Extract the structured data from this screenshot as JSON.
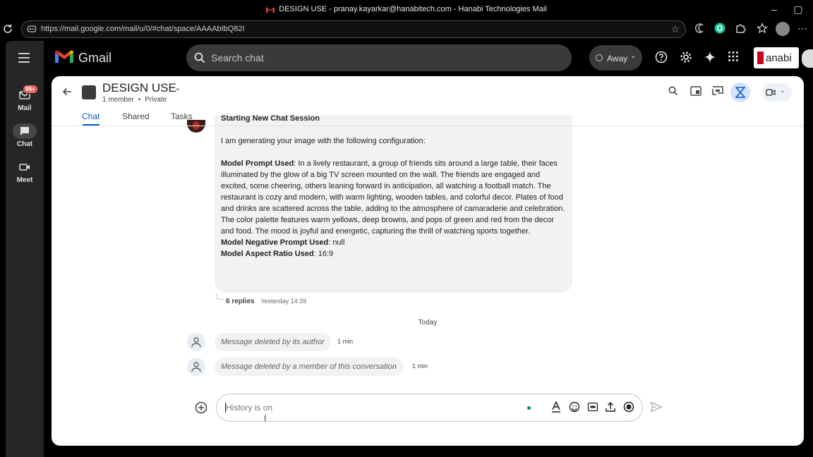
{
  "window": {
    "title": "DESIGN USE - pranay.kayarkar@hanabitech.com - Hanabi Technologies Mail",
    "minimize_label": "–",
    "maximize_label": "▢"
  },
  "browser": {
    "url": "https://mail.google.com/mail/u/0/#chat/space/AAAAbIbQ82I"
  },
  "header": {
    "product": "Gmail",
    "search_placeholder": "Search chat",
    "status": "Away",
    "brand": "anabi"
  },
  "sidebar": {
    "mail_badge": "99+",
    "items": [
      {
        "label": "Mail",
        "icon": "mail-icon",
        "active": false
      },
      {
        "label": "Chat",
        "icon": "chat-icon",
        "active": true
      },
      {
        "label": "Meet",
        "icon": "video-icon",
        "active": false
      }
    ]
  },
  "space": {
    "name": "DESIGN USE",
    "members": "1 member",
    "privacy": "Private",
    "separator": "•",
    "tabs": [
      "Chat",
      "Shared",
      "Tasks"
    ],
    "active_tab": "Chat"
  },
  "message": {
    "heading": "Starting New Chat Session",
    "intro": "I am generating your image with the following configuration:",
    "prompt_label": "Model Prompt Used",
    "prompt_text": ": In a lively restaurant, a group of friends sits around a large table, their faces illuminated by the glow of a big TV screen mounted on the wall. The friends are engaged and excited, some cheering, others leaning forward in anticipation, all watching a football match. The restaurant is cozy and modern, with warm lighting, wooden tables, and colorful decor. Plates of food and drinks are scattered across the table, adding to the atmosphere of camaraderie and celebration. The color palette features warm yellows, deep browns, and pops of green and red from the decor and food. The mood is joyful and energetic, capturing the thrill of watching sports together.",
    "negative_label": "Model Negative Prompt Used",
    "negative_value": ": null",
    "aspect_label": "Model Aspect Ratio Used",
    "aspect_value": ": 16:9",
    "replies": "6 replies",
    "replies_time": "Yesterday 14:39"
  },
  "date_divider": "Today",
  "deleted_messages": [
    {
      "text": "Message deleted by its author",
      "time": "1 min"
    },
    {
      "text": "Message deleted by a member of this conversation",
      "time": "1 min"
    }
  ],
  "composer": {
    "placeholder": "History is on"
  }
}
